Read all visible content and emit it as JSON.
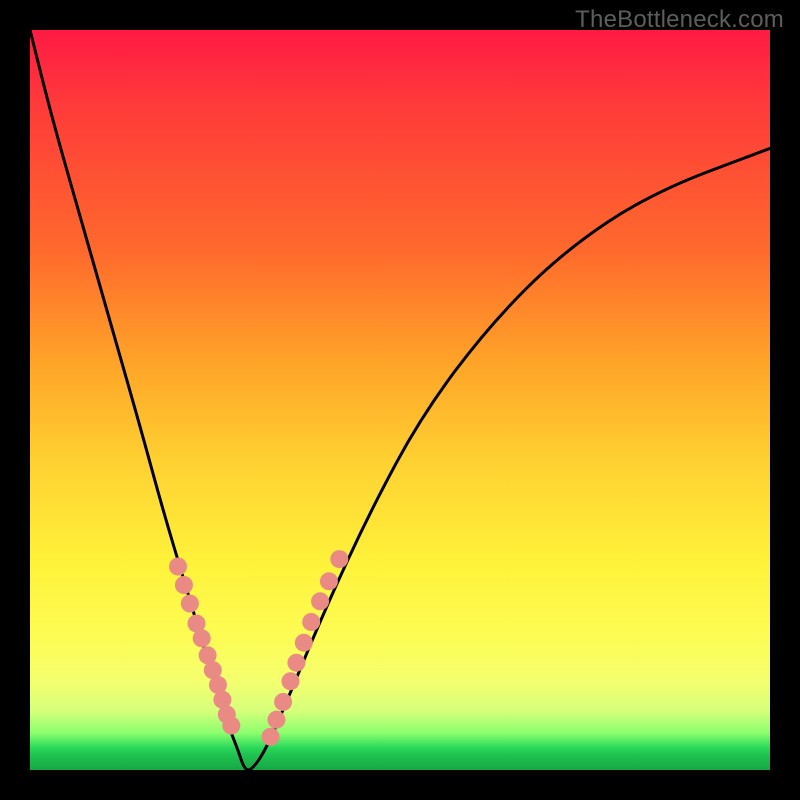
{
  "watermark": "TheBottleneck.com",
  "chart_data": {
    "type": "line",
    "title": "",
    "xlabel": "",
    "ylabel": "",
    "xlim": [
      0,
      1
    ],
    "ylim": [
      0,
      1
    ],
    "series": [
      {
        "name": "bottleneck-curve",
        "x": [
          0.0,
          0.03,
          0.07,
          0.11,
          0.15,
          0.18,
          0.21,
          0.24,
          0.26,
          0.28,
          0.29,
          0.3,
          0.32,
          0.35,
          0.4,
          0.46,
          0.53,
          0.62,
          0.72,
          0.84,
          1.0
        ],
        "y": [
          1.0,
          0.88,
          0.74,
          0.6,
          0.46,
          0.35,
          0.25,
          0.15,
          0.08,
          0.03,
          0.0,
          0.0,
          0.03,
          0.1,
          0.22,
          0.35,
          0.48,
          0.6,
          0.7,
          0.78,
          0.84
        ]
      },
      {
        "name": "highlight-dots-left",
        "x": [
          0.2,
          0.208,
          0.216,
          0.225,
          0.232,
          0.24,
          0.247,
          0.254,
          0.26,
          0.266,
          0.272
        ],
        "y": [
          0.275,
          0.25,
          0.225,
          0.198,
          0.178,
          0.155,
          0.135,
          0.115,
          0.095,
          0.075,
          0.06
        ]
      },
      {
        "name": "highlight-dots-right",
        "x": [
          0.325,
          0.333,
          0.342,
          0.352,
          0.36,
          0.37,
          0.38,
          0.392,
          0.404,
          0.418
        ],
        "y": [
          0.045,
          0.068,
          0.092,
          0.12,
          0.145,
          0.172,
          0.2,
          0.228,
          0.255,
          0.285
        ]
      }
    ],
    "colors": {
      "curve": "#000000",
      "dots": "#e98a85",
      "gradient_top": "#ff1a44",
      "gradient_mid": "#fff23a",
      "gradient_bottom": "#17a844"
    }
  }
}
